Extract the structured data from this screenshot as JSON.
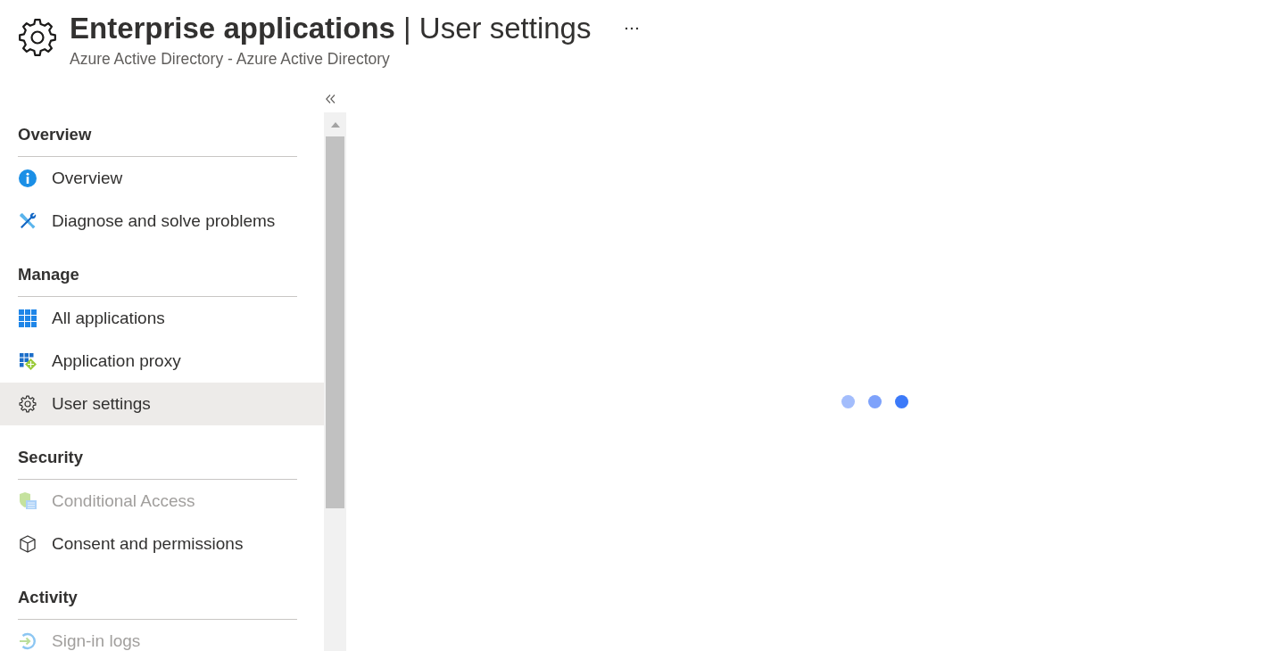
{
  "header": {
    "title": "**Enterprise applications** | User settings",
    "subtitle": "Azure Active Directory - Azure Active Directory"
  },
  "sidebar": {
    "sections": [
      {
        "heading": "Overview",
        "items": [
          {
            "label": "Overview",
            "selected": false,
            "disabled": false
          },
          {
            "label": "Diagnose and solve problems",
            "selected": false,
            "disabled": false
          }
        ]
      },
      {
        "heading": "Manage",
        "items": [
          {
            "label": "All applications",
            "selected": false,
            "disabled": false
          },
          {
            "label": "Application proxy",
            "selected": false,
            "disabled": false
          },
          {
            "label": "User settings",
            "selected": true,
            "disabled": false
          }
        ]
      },
      {
        "heading": "Security",
        "items": [
          {
            "label": "Conditional Access",
            "selected": false,
            "disabled": true
          },
          {
            "label": "Consent and permissions",
            "selected": false,
            "disabled": false
          }
        ]
      },
      {
        "heading": "Activity",
        "items": [
          {
            "label": "Sign-in logs",
            "selected": false,
            "disabled": true
          }
        ]
      }
    ]
  },
  "content": {
    "loading_dots": [
      {
        "color": "#a3bdfc"
      },
      {
        "color": "#7ea2fb"
      },
      {
        "color": "#3c7af9"
      }
    ]
  }
}
